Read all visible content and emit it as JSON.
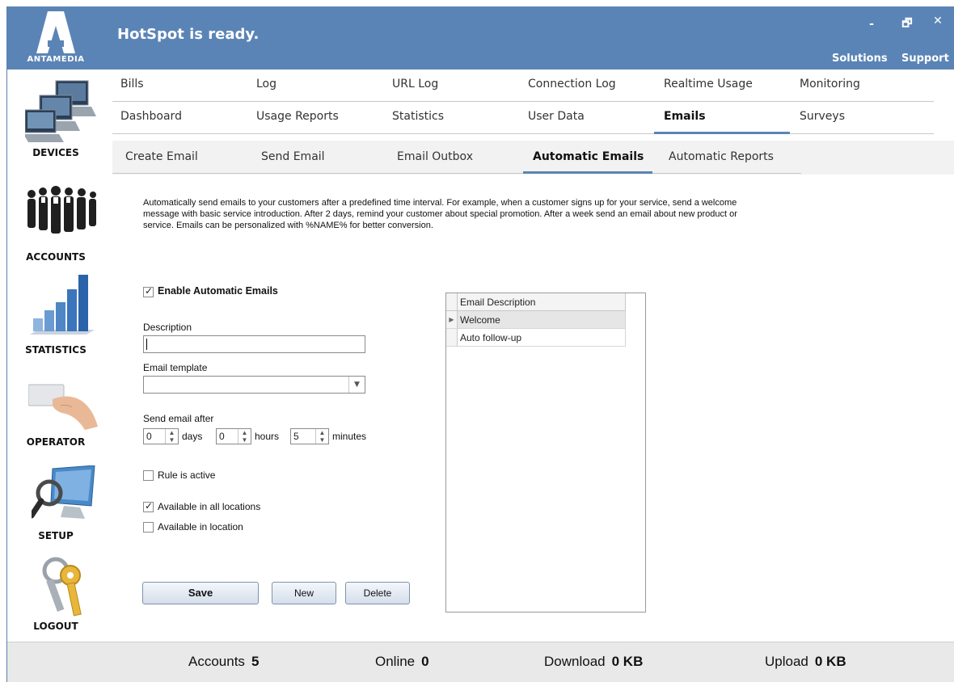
{
  "app": {
    "logo_text": "ANTAMEDIA",
    "status": "HotSpot is ready.",
    "window_buttons": {
      "minimize": "-",
      "restore": "🗗",
      "close": "✕"
    },
    "top_links": {
      "solutions": "Solutions",
      "support": "Support"
    }
  },
  "sidenav": {
    "items": [
      {
        "label": "DEVICES",
        "icon": "computers-icon"
      },
      {
        "label": "ACCOUNTS",
        "icon": "people-icon"
      },
      {
        "label": "STATISTICS",
        "icon": "bar-chart-icon"
      },
      {
        "label": "OPERATOR",
        "icon": "hand-card-icon"
      },
      {
        "label": "SETUP",
        "icon": "monitor-magnifier-icon"
      },
      {
        "label": "LOGOUT",
        "icon": "keys-icon"
      }
    ]
  },
  "tabs": {
    "row1": [
      "Bills",
      "Log",
      "URL Log",
      "Connection Log",
      "Realtime Usage",
      "Monitoring"
    ],
    "row2": [
      "Dashboard",
      "Usage Reports",
      "Statistics",
      "User Data",
      "Emails",
      "Surveys"
    ],
    "active": "Emails"
  },
  "subtabs": {
    "items": [
      "Create Email",
      "Send Email",
      "Email Outbox",
      "Automatic Emails",
      "Automatic Reports"
    ],
    "active": "Automatic Emails"
  },
  "content": {
    "description_line1": "Automatically send emails to your customers after a predefined time interval. For example, when a customer signs up for your service, send a welcome",
    "description_line2": "message with basic service introduction. After 2 days, remind your customer about special promotion. After a week send an email about new product or",
    "description_line3": "service.  Emails can be  personalized with %NAME% for better conversion.",
    "enable_label": "Enable Automatic Emails",
    "enable_checked": true,
    "description_label": "Description",
    "description_value": "",
    "template_label": "Email template",
    "template_value": "",
    "send_after_label": "Send email after",
    "days_value": "0",
    "days_label": "days",
    "hours_value": "0",
    "hours_label": "hours",
    "minutes_value": "5",
    "minutes_label": "minutes",
    "rule_active_label": "Rule is active",
    "rule_active_checked": false,
    "all_locations_label": "Available in all locations",
    "all_locations_checked": true,
    "in_location_label": "Available in location",
    "in_location_checked": false,
    "buttons": {
      "save": "Save",
      "new": "New",
      "delete": "Delete"
    }
  },
  "grid": {
    "header": "Email Description",
    "rows": [
      "Welcome",
      "Auto follow-up"
    ],
    "selected_index": 0
  },
  "statusbar": {
    "accounts_label": "Accounts",
    "accounts_value": "5",
    "online_label": "Online",
    "online_value": "0",
    "download_label": "Download",
    "download_value": "0 KB",
    "upload_label": "Upload",
    "upload_value": "0 KB"
  },
  "colors": {
    "titlebar": "#5b84b6",
    "accent": "#5b84b6",
    "statusbar": "#e9e9e9"
  }
}
